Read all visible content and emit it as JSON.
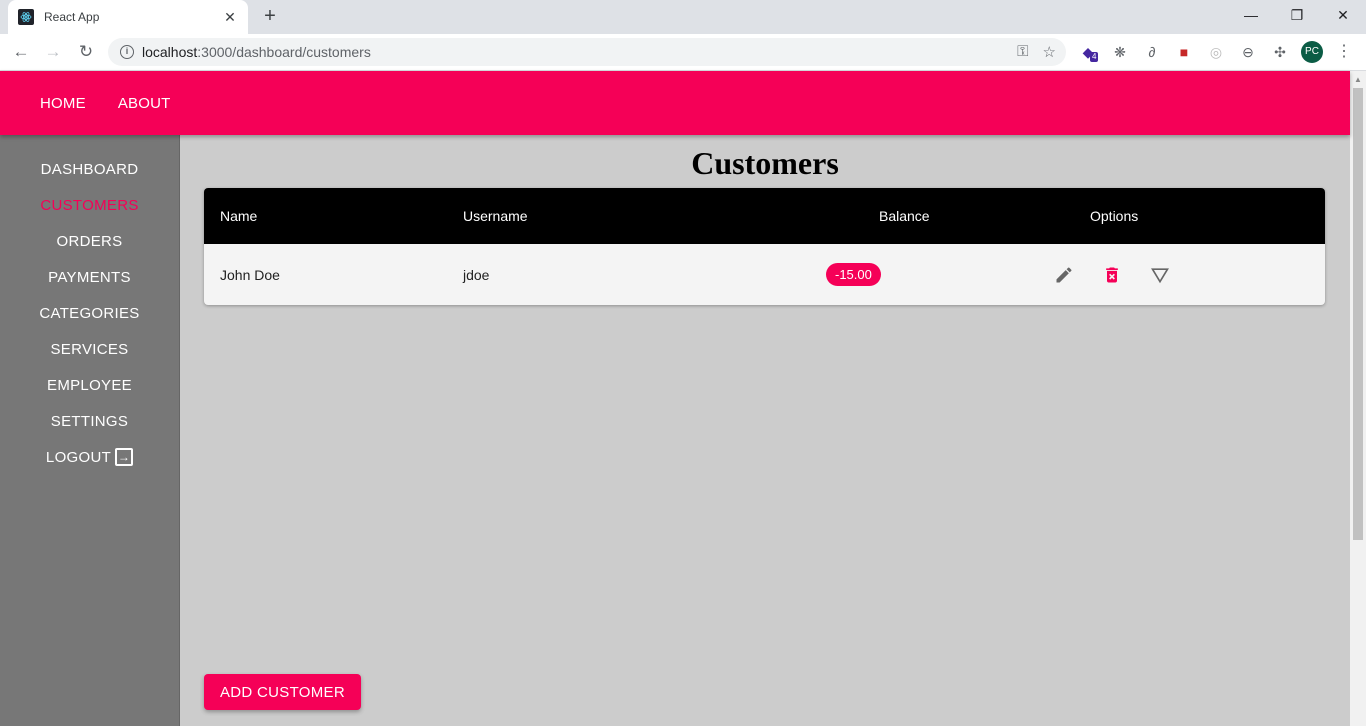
{
  "browser": {
    "tab_title": "React App",
    "url_host": "localhost",
    "url_path": ":3000/dashboard/customers",
    "avatar": "PC",
    "ext_badge": "4"
  },
  "appbar": {
    "links": [
      "HOME",
      "ABOUT"
    ]
  },
  "sidebar": {
    "items": [
      {
        "label": "DASHBOARD",
        "active": false
      },
      {
        "label": "CUSTOMERS",
        "active": true
      },
      {
        "label": "ORDERS",
        "active": false
      },
      {
        "label": "PAYMENTS",
        "active": false
      },
      {
        "label": "CATEGORIES",
        "active": false
      },
      {
        "label": "SERVICES",
        "active": false
      },
      {
        "label": "EMPLOYEE",
        "active": false
      },
      {
        "label": "SETTINGS",
        "active": false
      },
      {
        "label": "LOGOUT",
        "active": false
      }
    ]
  },
  "main": {
    "title": "Customers",
    "table": {
      "headers": [
        "Name",
        "Username",
        "Balance",
        "Options"
      ],
      "rows": [
        {
          "name": "John Doe",
          "username": "jdoe",
          "balance": "-15.00"
        }
      ]
    },
    "add_button": "ADD CUSTOMER"
  },
  "colors": {
    "accent": "#f50057",
    "sidebar": "#777777",
    "background": "#cccccc"
  }
}
